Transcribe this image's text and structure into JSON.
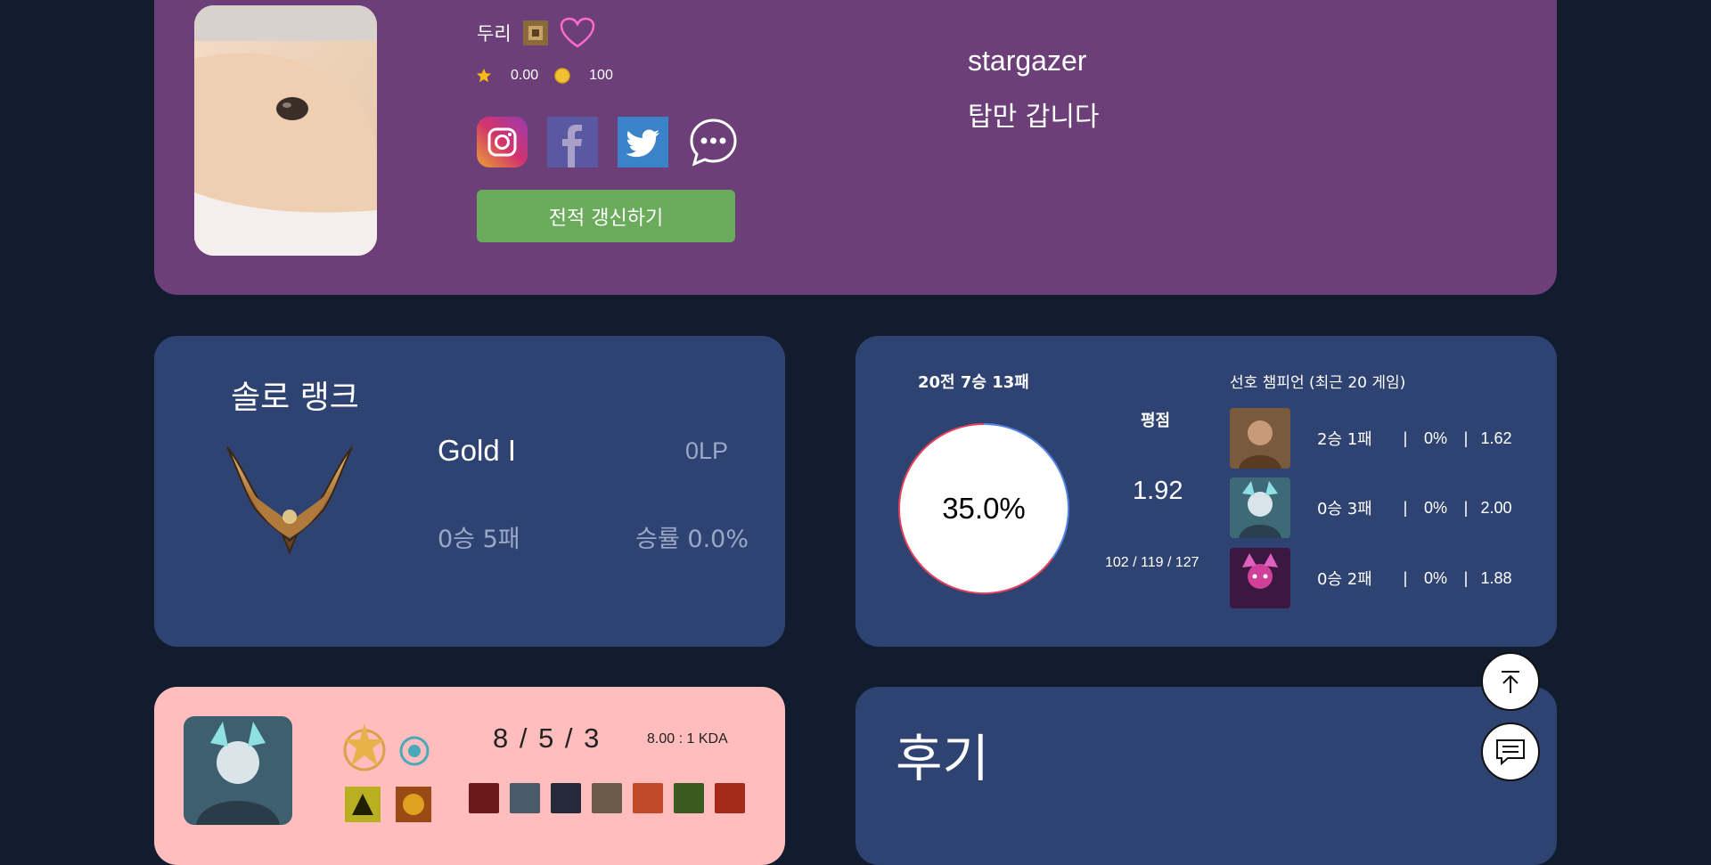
{
  "profile": {
    "nickname": "두리",
    "rating": "0.00",
    "coins": "100",
    "refresh_label": "전적 갱신하기",
    "username": "stargazer",
    "bio": "탑만 갑니다",
    "socials": [
      "instagram-icon",
      "facebook-icon",
      "twitter-icon",
      "chat-bubble-icon"
    ]
  },
  "rank": {
    "title": "솔로 랭크",
    "tier": "Gold I",
    "lp": "0LP",
    "record": "0승 5패",
    "winrate": "승률 0.0%"
  },
  "stats": {
    "record": "20전 7승 13패",
    "winrate_label": "35.0%",
    "win_fraction": 0.35,
    "rating_label": "평점",
    "rating_value": "1.92",
    "kda_totals": "102 / 119 / 127",
    "pref_title": "선호 챔피언 (최근 20 게임)",
    "champions": [
      {
        "record": "2승 1패",
        "pct": "0%",
        "kda": "1.62",
        "color": "#7a5a3c"
      },
      {
        "record": "0승 3패",
        "pct": "0%",
        "kda": "2.00",
        "color": "#4f7a86"
      },
      {
        "record": "0승 2패",
        "pct": "0%",
        "kda": "1.88",
        "color": "#7a2a6e"
      }
    ],
    "colors": {
      "win": "#5485e8",
      "loss": "#e8415a"
    }
  },
  "match": {
    "kda": "8 / 5 / 3",
    "ratio": "8.00 : 1 KDA"
  },
  "review": {
    "title": "후기"
  }
}
